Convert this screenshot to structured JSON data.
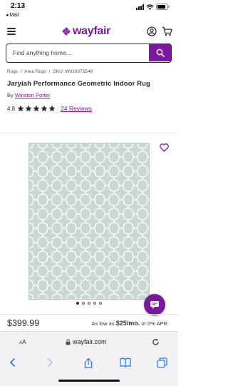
{
  "status_bar": {
    "time": "2:13",
    "back_app": "◂ Mail"
  },
  "header": {
    "logo_text": "wayfair",
    "brand_color": "#7b189f",
    "menu_icon": "hamburger-icon",
    "account_icon": "account-icon",
    "cart_icon": "cart-icon"
  },
  "search": {
    "placeholder": "Find anything home...",
    "button_icon": "search-icon"
  },
  "breadcrumb": {
    "items": [
      "Rugs",
      "Area Rugs"
    ],
    "separator": "/",
    "sku": "SKU: W010373548"
  },
  "product": {
    "title": "Jaryiah Performance Geometric Indoor Rug",
    "by_label": "By",
    "brand": "Winston Porter",
    "rating": "4.8",
    "stars": 5,
    "reviews": "24 Reviews"
  },
  "gallery": {
    "image_subject": "rug-image",
    "rug_color": "#c9d9d2",
    "pattern_color": "#f3f6f4",
    "dots_total": 5,
    "dots_active": 1,
    "favorite_icon": "heart-outline-icon",
    "chat_icon": "chat-icon"
  },
  "pricing": {
    "price": "$399.99",
    "as_low_as": "As low as",
    "monthly": "$25/mo.",
    "apr_text": "or 0% APR"
  },
  "safari": {
    "text_size_small": "A",
    "text_size_large": "A",
    "url": "wayfair.com",
    "lock_icon": "lock-icon",
    "reload_icon": "reload-icon"
  },
  "toolbar": {
    "icons": [
      "back-icon",
      "forward-icon",
      "share-icon",
      "bookmarks-icon",
      "tabs-icon"
    ]
  }
}
